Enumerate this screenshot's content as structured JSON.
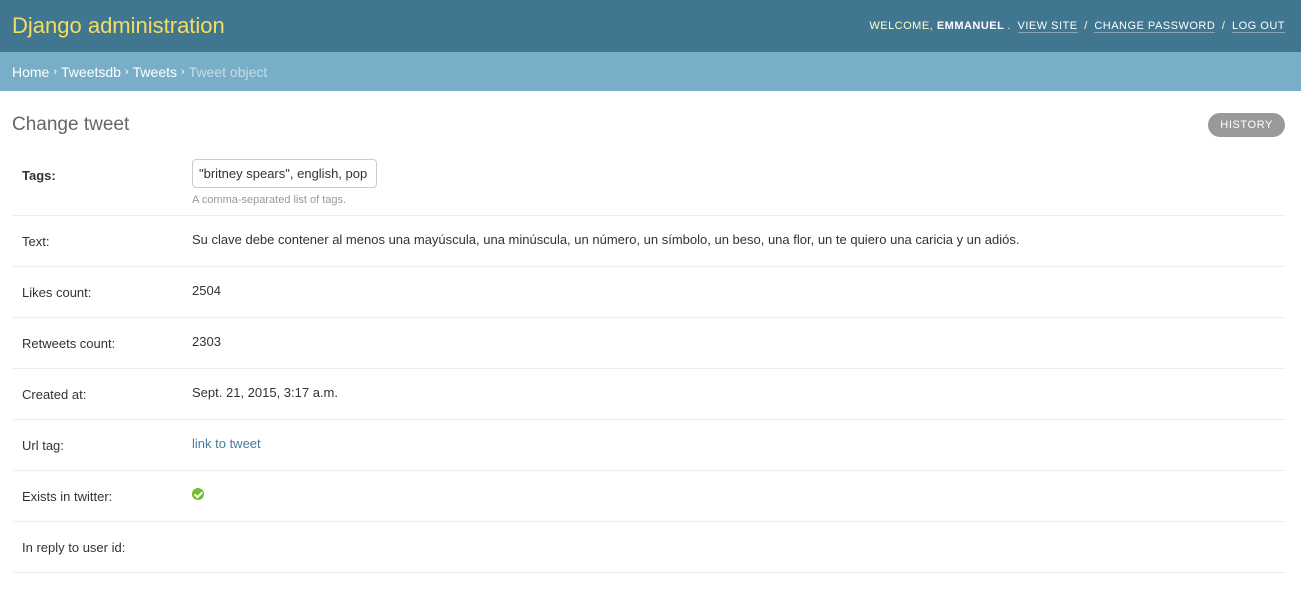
{
  "header": {
    "branding": "Django administration",
    "welcome": "Welcome,",
    "username": "Emmanuel",
    "view_site": "View site",
    "change_password": "Change password",
    "log_out": "Log out"
  },
  "breadcrumbs": {
    "home": "Home",
    "app": "Tweetsdb",
    "model": "Tweets",
    "current": "Tweet object"
  },
  "page": {
    "title": "Change tweet",
    "history": "History"
  },
  "form": {
    "tags": {
      "label": "Tags:",
      "value": "\"britney spears\", english, pop",
      "help": "A comma-separated list of tags."
    },
    "text": {
      "label": "Text:",
      "value": "Su clave debe contener al menos una mayúscula, una minúscula, un número, un símbolo, un beso, una flor, un te quiero una caricia y un adiós."
    },
    "likes_count": {
      "label": "Likes count:",
      "value": "2504"
    },
    "retweets_count": {
      "label": "Retweets count:",
      "value": "2303"
    },
    "created_at": {
      "label": "Created at:",
      "value": "Sept. 21, 2015, 3:17 a.m."
    },
    "url_tag": {
      "label": "Url tag:",
      "value": "link to tweet"
    },
    "exists_in_twitter": {
      "label": "Exists in twitter:",
      "icon": "check-circle-icon",
      "value": true
    },
    "in_reply_to_user_id": {
      "label": "In reply to user id:",
      "value": ""
    }
  },
  "colors": {
    "header_bg": "#417690",
    "branding": "#f5dd5d",
    "breadcrumbs_bg": "#79aec8",
    "link": "#447e9b",
    "success": "#70bf2b"
  }
}
